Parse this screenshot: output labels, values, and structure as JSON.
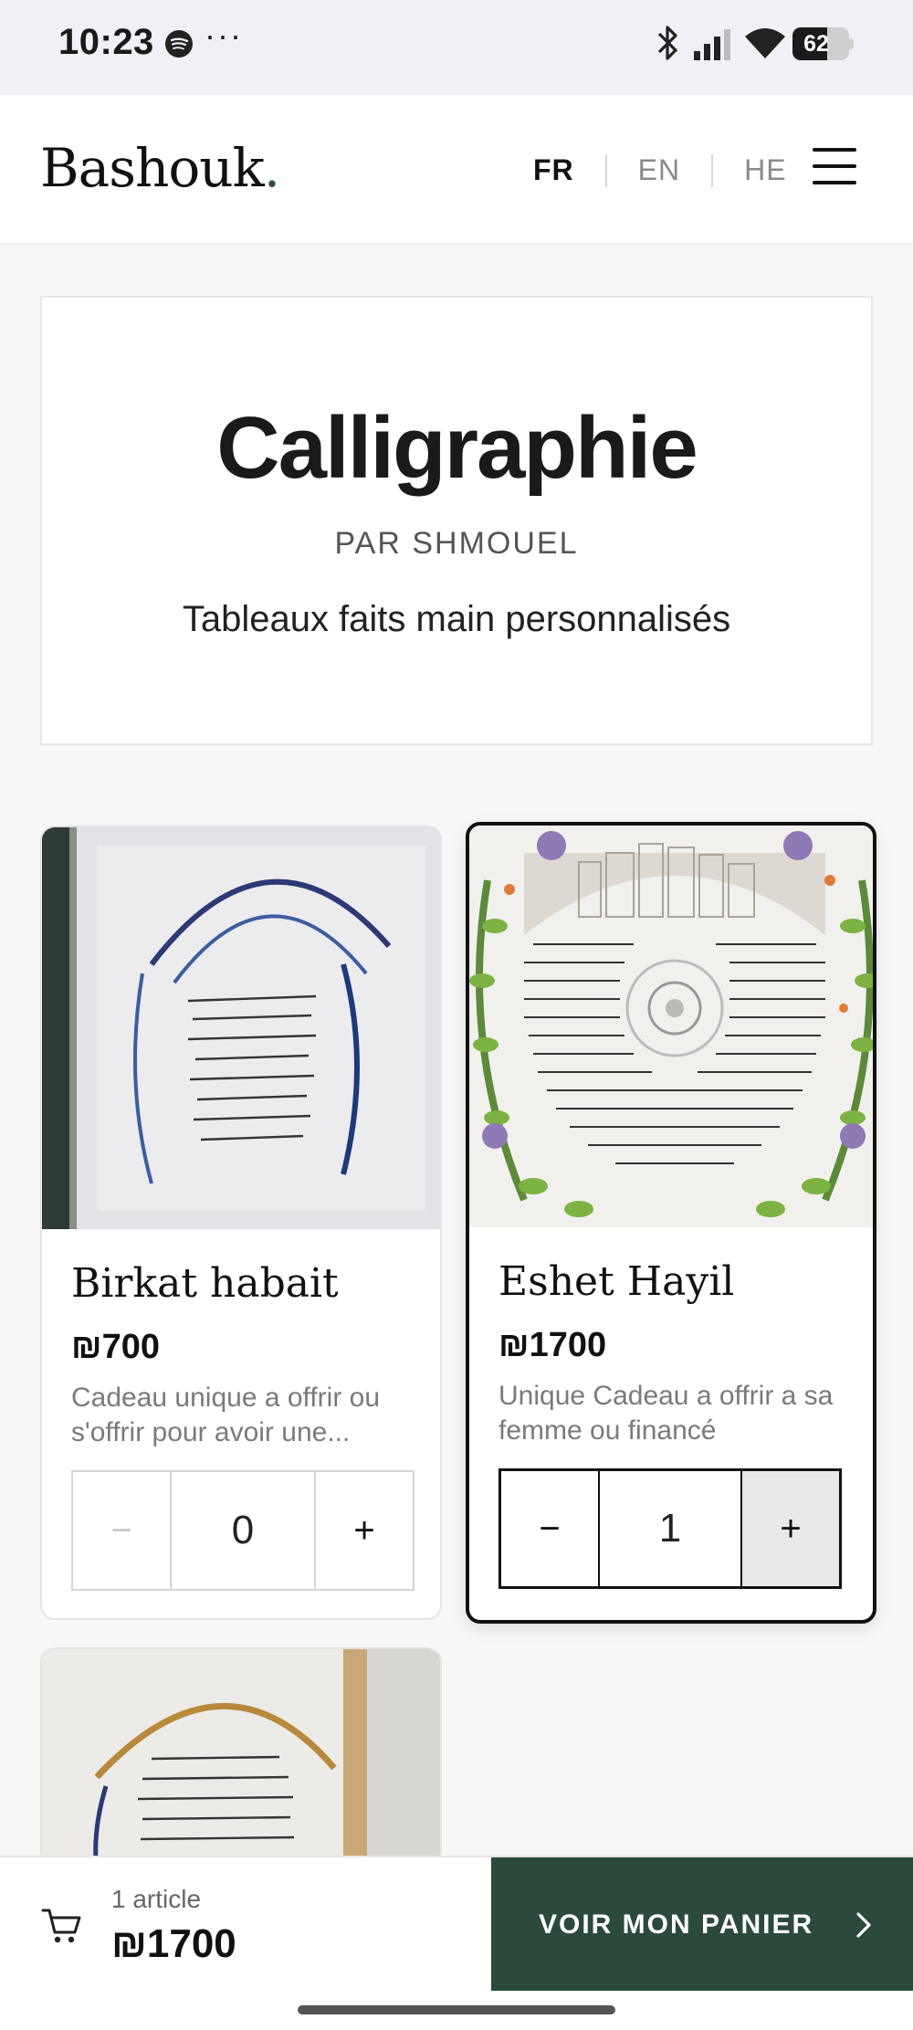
{
  "status_bar": {
    "time": "10:23",
    "dots": "···",
    "battery_level": "62",
    "icons": [
      "spotify-icon",
      "bluetooth-icon",
      "signal-icon",
      "wifi-icon",
      "battery-icon"
    ]
  },
  "header": {
    "logo": "Bashouk",
    "logo_dot": ".",
    "languages": [
      {
        "code": "FR",
        "active": true
      },
      {
        "code": "EN",
        "active": false
      },
      {
        "code": "HE",
        "active": false
      }
    ],
    "menu_icon": "hamburger-menu-icon"
  },
  "hero": {
    "title": "Calligraphie",
    "subtitle": "PAR SHMOUEL",
    "tagline": "Tableaux faits main personnalisés"
  },
  "products": [
    {
      "name": "Birkat habait",
      "price": "₪700",
      "description": "Cadeau unique a offrir ou s'offrir pour avoir une...",
      "quantity": "0",
      "selected": false,
      "minus_label": "−",
      "plus_label": "+"
    },
    {
      "name": "Eshet Hayil",
      "price": "₪1700",
      "description": "Unique Cadeau a offrir a sa femme ou financé",
      "quantity": "1",
      "selected": true,
      "minus_label": "−",
      "plus_label": "+"
    },
    {
      "name": "",
      "price": "",
      "description": "",
      "quantity": "",
      "selected": false
    }
  ],
  "cart": {
    "count_label": "1 article",
    "total": "₪1700",
    "checkout_label": "VOIR MON PANIER"
  },
  "colors": {
    "accent": "#2c4a3b",
    "text": "#1a1a1a",
    "muted": "#7a7a7a",
    "background": "#f7f7f8"
  }
}
